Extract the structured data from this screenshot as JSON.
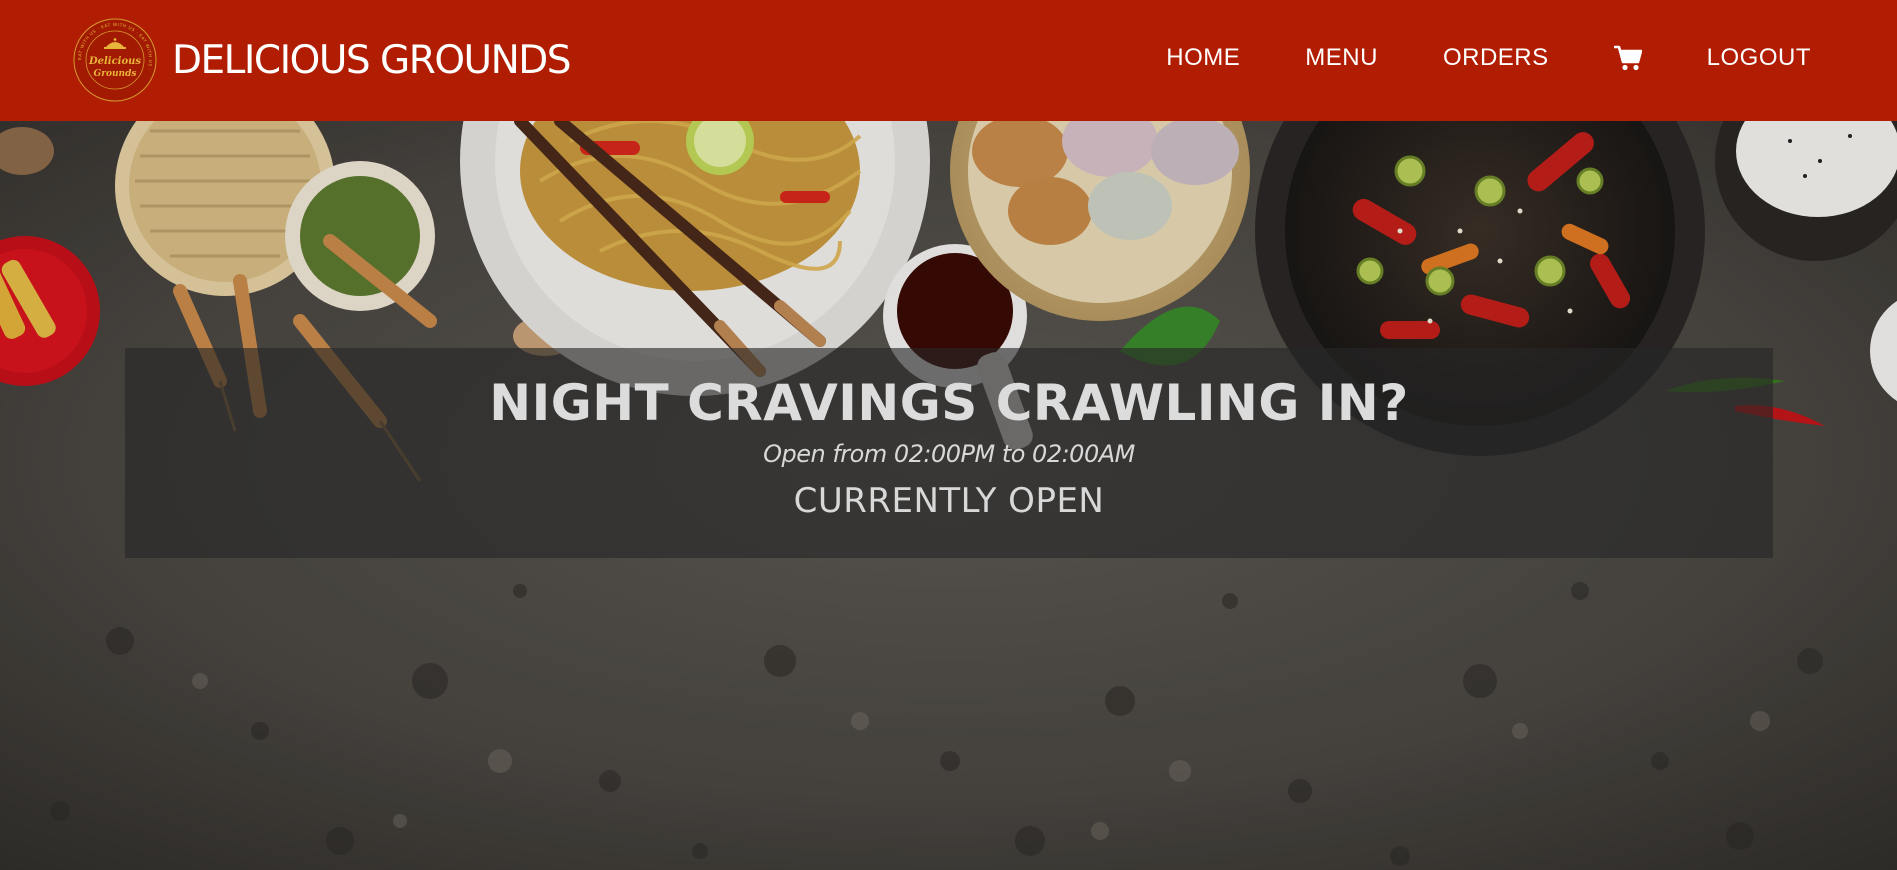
{
  "brand": {
    "name": "DELICIOUS GROUNDS",
    "logo_text_line1": "Delicious",
    "logo_text_line2": "Grounds",
    "logo_ring_text": "EAT WITH US · EAT WITH US · EAT WITH US ·"
  },
  "nav": {
    "home": "HOME",
    "menu": "MENU",
    "orders": "ORDERS",
    "cart_icon": "cart-icon",
    "logout": "LOGOUT"
  },
  "hero": {
    "title": "NIGHT CRAVINGS CRAWLING IN?",
    "hours": "Open from 02:00PM to 02:00AM",
    "status": "CURRENTLY OPEN"
  },
  "colors": {
    "header_bg": "#b01d02",
    "header_text": "#ffffff",
    "banner_bg": "rgba(38,38,38,0.62)",
    "banner_text": "#dcdcdc",
    "logo_gold": "#e8b53a"
  }
}
